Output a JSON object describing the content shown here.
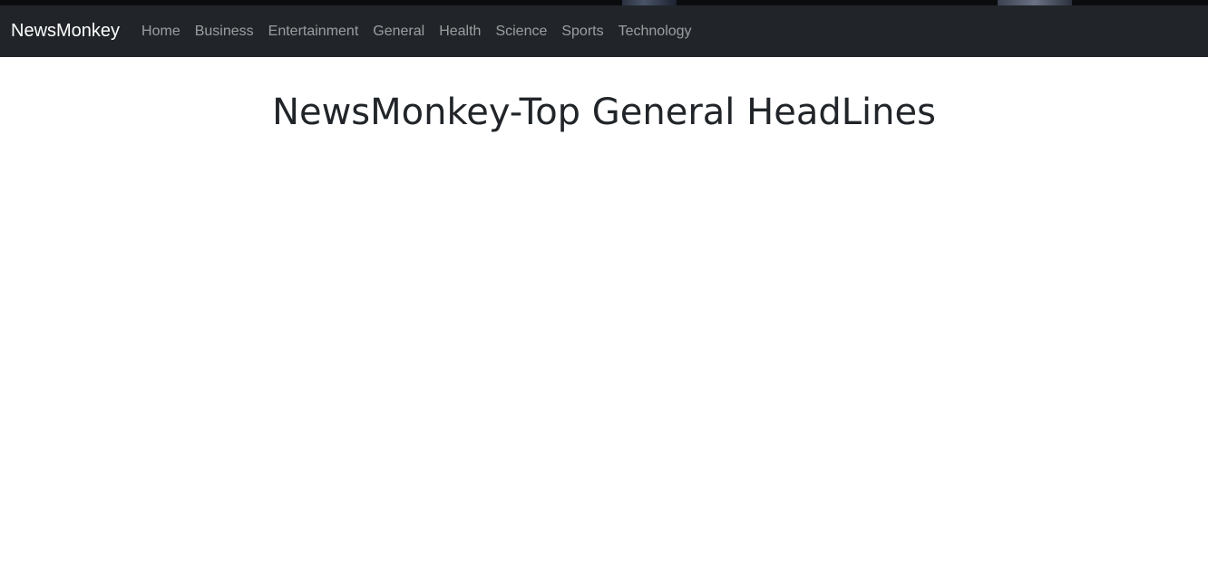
{
  "navbar": {
    "brand": "NewsMonkey",
    "links": [
      {
        "label": "Home"
      },
      {
        "label": "Business"
      },
      {
        "label": "Entertainment"
      },
      {
        "label": "General"
      },
      {
        "label": "Health"
      },
      {
        "label": "Science"
      },
      {
        "label": "Sports"
      },
      {
        "label": "Technology"
      }
    ]
  },
  "main": {
    "title": "NewsMonkey-Top General HeadLines"
  },
  "colors": {
    "navbar_bg": "#212529",
    "brand_text": "#ffffff",
    "link_text": "rgba(255,255,255,0.55)",
    "title_text": "#212529",
    "page_bg": "#ffffff"
  }
}
